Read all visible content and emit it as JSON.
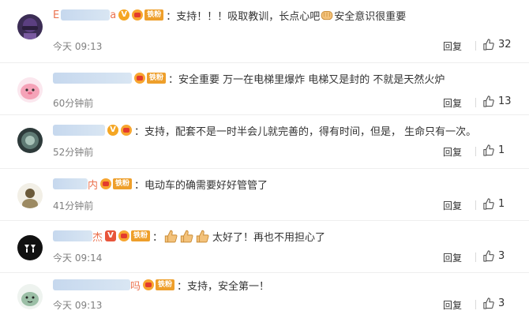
{
  "comments": [
    {
      "username_visible": "E",
      "username_suffix": "a",
      "content": "：支持！！！吸取教训，长点心吧",
      "content_tail": "安全意识很重要",
      "time": "今天 09:13",
      "reply": "回复",
      "likes": "32",
      "badge_fan": "铁粉"
    },
    {
      "username_visible": "",
      "username_suffix": "",
      "content": "：安全重要 万一在电梯里爆炸 电梯又是封的 不就是天然火炉",
      "time": "60分钟前",
      "reply": "回复",
      "likes": "13",
      "badge_fan": "铁粉"
    },
    {
      "username_visible": "",
      "username_suffix": "",
      "content": "：支持，配套不是一时半会儿就完善的，得有时间，但是， 生命只有一次。",
      "time": "52分钟前",
      "reply": "回复",
      "likes": "1"
    },
    {
      "username_visible": "",
      "username_suffix": "内",
      "content": "：电动车的确需要好好管管了",
      "time": "41分钟前",
      "reply": "回复",
      "likes": "1",
      "badge_fan": "铁粉"
    },
    {
      "username_visible": "",
      "username_suffix": "杰",
      "content": "：",
      "content_tail": "太好了！再也不用担心了",
      "time": "今天 09:14",
      "reply": "回复",
      "likes": "3",
      "badge_fan": "铁粉"
    },
    {
      "username_visible": "",
      "username_suffix": "吗",
      "content": "：支持，安全第一！",
      "time": "今天 09:13",
      "reply": "回复",
      "likes": "3",
      "badge_fan": "铁粉"
    }
  ],
  "icons": {
    "like": "thumbs-up-icon",
    "verified": "v-badge-icon",
    "member": "member-badge-icon"
  },
  "colors": {
    "username": "#eb7350",
    "text": "#333333",
    "time": "#808080",
    "fan_badge": "#ee9f2b",
    "verified": "#f5a623"
  }
}
